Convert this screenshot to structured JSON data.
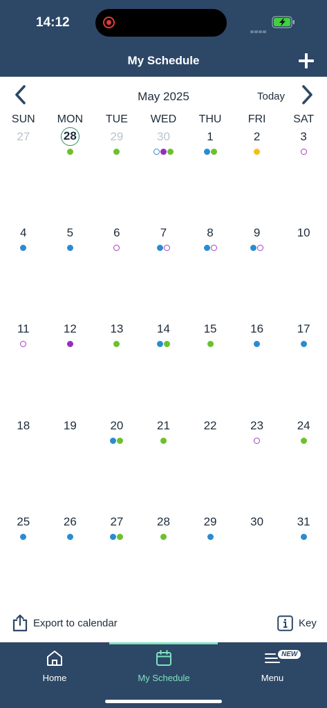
{
  "status": {
    "time": "14:12"
  },
  "header": {
    "title": "My Schedule",
    "add_label": "+"
  },
  "calendar": {
    "month_label": "May 2025",
    "today_label": "Today",
    "weekdays": [
      "SUN",
      "MON",
      "TUE",
      "WED",
      "THU",
      "FRI",
      "SAT"
    ],
    "weeks": [
      [
        {
          "num": "27",
          "other": true,
          "dots": []
        },
        {
          "num": "28",
          "other": false,
          "today": true,
          "dots": [
            "green"
          ]
        },
        {
          "num": "29",
          "other": true,
          "dots": [
            "green"
          ]
        },
        {
          "num": "30",
          "other": true,
          "dots": [
            "ring-blue",
            "purple",
            "green"
          ]
        },
        {
          "num": "1",
          "dots": [
            "blue",
            "green"
          ]
        },
        {
          "num": "2",
          "dots": [
            "yellow"
          ]
        },
        {
          "num": "3",
          "dots": [
            "ring-purple"
          ]
        }
      ],
      [
        {
          "num": "4",
          "dots": [
            "blue"
          ]
        },
        {
          "num": "5",
          "dots": [
            "blue"
          ]
        },
        {
          "num": "6",
          "dots": [
            "ring-purple"
          ]
        },
        {
          "num": "7",
          "dots": [
            "blue",
            "ring-purple"
          ]
        },
        {
          "num": "8",
          "dots": [
            "blue",
            "ring-purple"
          ]
        },
        {
          "num": "9",
          "dots": [
            "blue",
            "ring-purple"
          ]
        },
        {
          "num": "10",
          "dots": []
        }
      ],
      [
        {
          "num": "11",
          "dots": [
            "ring-purple"
          ]
        },
        {
          "num": "12",
          "dots": [
            "purple"
          ]
        },
        {
          "num": "13",
          "dots": [
            "green"
          ]
        },
        {
          "num": "14",
          "dots": [
            "blue",
            "green"
          ]
        },
        {
          "num": "15",
          "dots": [
            "green"
          ]
        },
        {
          "num": "16",
          "dots": [
            "blue"
          ]
        },
        {
          "num": "17",
          "dots": [
            "blue"
          ]
        }
      ],
      [
        {
          "num": "18",
          "dots": []
        },
        {
          "num": "19",
          "dots": []
        },
        {
          "num": "20",
          "dots": [
            "blue",
            "green"
          ]
        },
        {
          "num": "21",
          "dots": [
            "green"
          ]
        },
        {
          "num": "22",
          "dots": []
        },
        {
          "num": "23",
          "dots": [
            "ring-purple"
          ]
        },
        {
          "num": "24",
          "dots": [
            "green"
          ]
        }
      ],
      [
        {
          "num": "25",
          "dots": [
            "blue"
          ]
        },
        {
          "num": "26",
          "dots": [
            "blue"
          ]
        },
        {
          "num": "27",
          "dots": [
            "blue",
            "green"
          ]
        },
        {
          "num": "28",
          "dots": [
            "green"
          ]
        },
        {
          "num": "29",
          "dots": [
            "blue"
          ]
        },
        {
          "num": "30",
          "dots": []
        },
        {
          "num": "31",
          "dots": [
            "blue"
          ]
        }
      ]
    ]
  },
  "actions": {
    "export_label": "Export to calendar",
    "key_label": "Key"
  },
  "tabs": {
    "home": "Home",
    "schedule": "My Schedule",
    "menu": "Menu",
    "new_badge": "NEW"
  },
  "colors": {
    "header_bg": "#2d4766",
    "accent": "#7fe3c0",
    "today_ring": "#2f8c5e",
    "event_blue": "#2a8bd0",
    "event_green": "#6cc12a",
    "event_purple": "#952ec2",
    "event_yellow": "#f3bf1b"
  }
}
